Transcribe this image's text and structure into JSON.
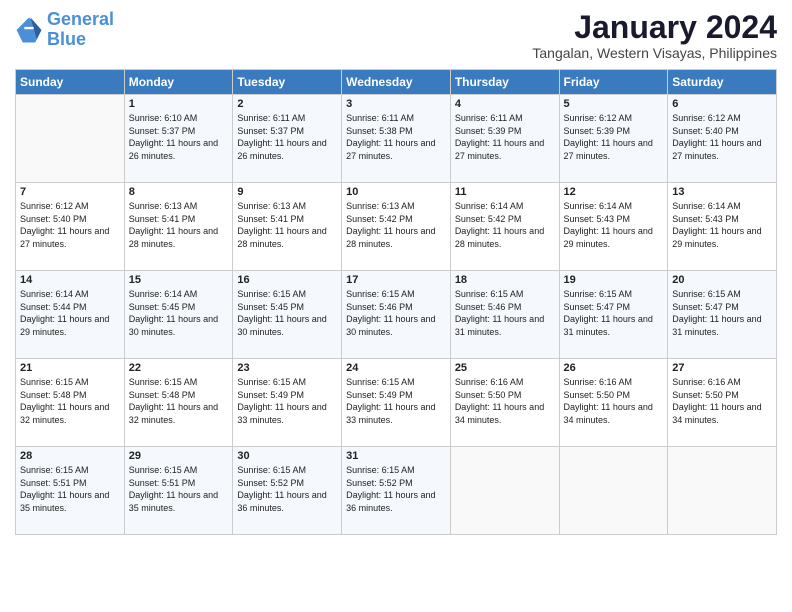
{
  "logo": {
    "line1": "General",
    "line2": "Blue"
  },
  "title": "January 2024",
  "subtitle": "Tangalan, Western Visayas, Philippines",
  "weekdays": [
    "Sunday",
    "Monday",
    "Tuesday",
    "Wednesday",
    "Thursday",
    "Friday",
    "Saturday"
  ],
  "weeks": [
    [
      {
        "day": "",
        "sunrise": "",
        "sunset": "",
        "daylight": ""
      },
      {
        "day": "1",
        "sunrise": "Sunrise: 6:10 AM",
        "sunset": "Sunset: 5:37 PM",
        "daylight": "Daylight: 11 hours and 26 minutes."
      },
      {
        "day": "2",
        "sunrise": "Sunrise: 6:11 AM",
        "sunset": "Sunset: 5:37 PM",
        "daylight": "Daylight: 11 hours and 26 minutes."
      },
      {
        "day": "3",
        "sunrise": "Sunrise: 6:11 AM",
        "sunset": "Sunset: 5:38 PM",
        "daylight": "Daylight: 11 hours and 27 minutes."
      },
      {
        "day": "4",
        "sunrise": "Sunrise: 6:11 AM",
        "sunset": "Sunset: 5:39 PM",
        "daylight": "Daylight: 11 hours and 27 minutes."
      },
      {
        "day": "5",
        "sunrise": "Sunrise: 6:12 AM",
        "sunset": "Sunset: 5:39 PM",
        "daylight": "Daylight: 11 hours and 27 minutes."
      },
      {
        "day": "6",
        "sunrise": "Sunrise: 6:12 AM",
        "sunset": "Sunset: 5:40 PM",
        "daylight": "Daylight: 11 hours and 27 minutes."
      }
    ],
    [
      {
        "day": "7",
        "sunrise": "Sunrise: 6:12 AM",
        "sunset": "Sunset: 5:40 PM",
        "daylight": "Daylight: 11 hours and 27 minutes."
      },
      {
        "day": "8",
        "sunrise": "Sunrise: 6:13 AM",
        "sunset": "Sunset: 5:41 PM",
        "daylight": "Daylight: 11 hours and 28 minutes."
      },
      {
        "day": "9",
        "sunrise": "Sunrise: 6:13 AM",
        "sunset": "Sunset: 5:41 PM",
        "daylight": "Daylight: 11 hours and 28 minutes."
      },
      {
        "day": "10",
        "sunrise": "Sunrise: 6:13 AM",
        "sunset": "Sunset: 5:42 PM",
        "daylight": "Daylight: 11 hours and 28 minutes."
      },
      {
        "day": "11",
        "sunrise": "Sunrise: 6:14 AM",
        "sunset": "Sunset: 5:42 PM",
        "daylight": "Daylight: 11 hours and 28 minutes."
      },
      {
        "day": "12",
        "sunrise": "Sunrise: 6:14 AM",
        "sunset": "Sunset: 5:43 PM",
        "daylight": "Daylight: 11 hours and 29 minutes."
      },
      {
        "day": "13",
        "sunrise": "Sunrise: 6:14 AM",
        "sunset": "Sunset: 5:43 PM",
        "daylight": "Daylight: 11 hours and 29 minutes."
      }
    ],
    [
      {
        "day": "14",
        "sunrise": "Sunrise: 6:14 AM",
        "sunset": "Sunset: 5:44 PM",
        "daylight": "Daylight: 11 hours and 29 minutes."
      },
      {
        "day": "15",
        "sunrise": "Sunrise: 6:14 AM",
        "sunset": "Sunset: 5:45 PM",
        "daylight": "Daylight: 11 hours and 30 minutes."
      },
      {
        "day": "16",
        "sunrise": "Sunrise: 6:15 AM",
        "sunset": "Sunset: 5:45 PM",
        "daylight": "Daylight: 11 hours and 30 minutes."
      },
      {
        "day": "17",
        "sunrise": "Sunrise: 6:15 AM",
        "sunset": "Sunset: 5:46 PM",
        "daylight": "Daylight: 11 hours and 30 minutes."
      },
      {
        "day": "18",
        "sunrise": "Sunrise: 6:15 AM",
        "sunset": "Sunset: 5:46 PM",
        "daylight": "Daylight: 11 hours and 31 minutes."
      },
      {
        "day": "19",
        "sunrise": "Sunrise: 6:15 AM",
        "sunset": "Sunset: 5:47 PM",
        "daylight": "Daylight: 11 hours and 31 minutes."
      },
      {
        "day": "20",
        "sunrise": "Sunrise: 6:15 AM",
        "sunset": "Sunset: 5:47 PM",
        "daylight": "Daylight: 11 hours and 31 minutes."
      }
    ],
    [
      {
        "day": "21",
        "sunrise": "Sunrise: 6:15 AM",
        "sunset": "Sunset: 5:48 PM",
        "daylight": "Daylight: 11 hours and 32 minutes."
      },
      {
        "day": "22",
        "sunrise": "Sunrise: 6:15 AM",
        "sunset": "Sunset: 5:48 PM",
        "daylight": "Daylight: 11 hours and 32 minutes."
      },
      {
        "day": "23",
        "sunrise": "Sunrise: 6:15 AM",
        "sunset": "Sunset: 5:49 PM",
        "daylight": "Daylight: 11 hours and 33 minutes."
      },
      {
        "day": "24",
        "sunrise": "Sunrise: 6:15 AM",
        "sunset": "Sunset: 5:49 PM",
        "daylight": "Daylight: 11 hours and 33 minutes."
      },
      {
        "day": "25",
        "sunrise": "Sunrise: 6:16 AM",
        "sunset": "Sunset: 5:50 PM",
        "daylight": "Daylight: 11 hours and 34 minutes."
      },
      {
        "day": "26",
        "sunrise": "Sunrise: 6:16 AM",
        "sunset": "Sunset: 5:50 PM",
        "daylight": "Daylight: 11 hours and 34 minutes."
      },
      {
        "day": "27",
        "sunrise": "Sunrise: 6:16 AM",
        "sunset": "Sunset: 5:50 PM",
        "daylight": "Daylight: 11 hours and 34 minutes."
      }
    ],
    [
      {
        "day": "28",
        "sunrise": "Sunrise: 6:15 AM",
        "sunset": "Sunset: 5:51 PM",
        "daylight": "Daylight: 11 hours and 35 minutes."
      },
      {
        "day": "29",
        "sunrise": "Sunrise: 6:15 AM",
        "sunset": "Sunset: 5:51 PM",
        "daylight": "Daylight: 11 hours and 35 minutes."
      },
      {
        "day": "30",
        "sunrise": "Sunrise: 6:15 AM",
        "sunset": "Sunset: 5:52 PM",
        "daylight": "Daylight: 11 hours and 36 minutes."
      },
      {
        "day": "31",
        "sunrise": "Sunrise: 6:15 AM",
        "sunset": "Sunset: 5:52 PM",
        "daylight": "Daylight: 11 hours and 36 minutes."
      },
      {
        "day": "",
        "sunrise": "",
        "sunset": "",
        "daylight": ""
      },
      {
        "day": "",
        "sunrise": "",
        "sunset": "",
        "daylight": ""
      },
      {
        "day": "",
        "sunrise": "",
        "sunset": "",
        "daylight": ""
      }
    ]
  ]
}
